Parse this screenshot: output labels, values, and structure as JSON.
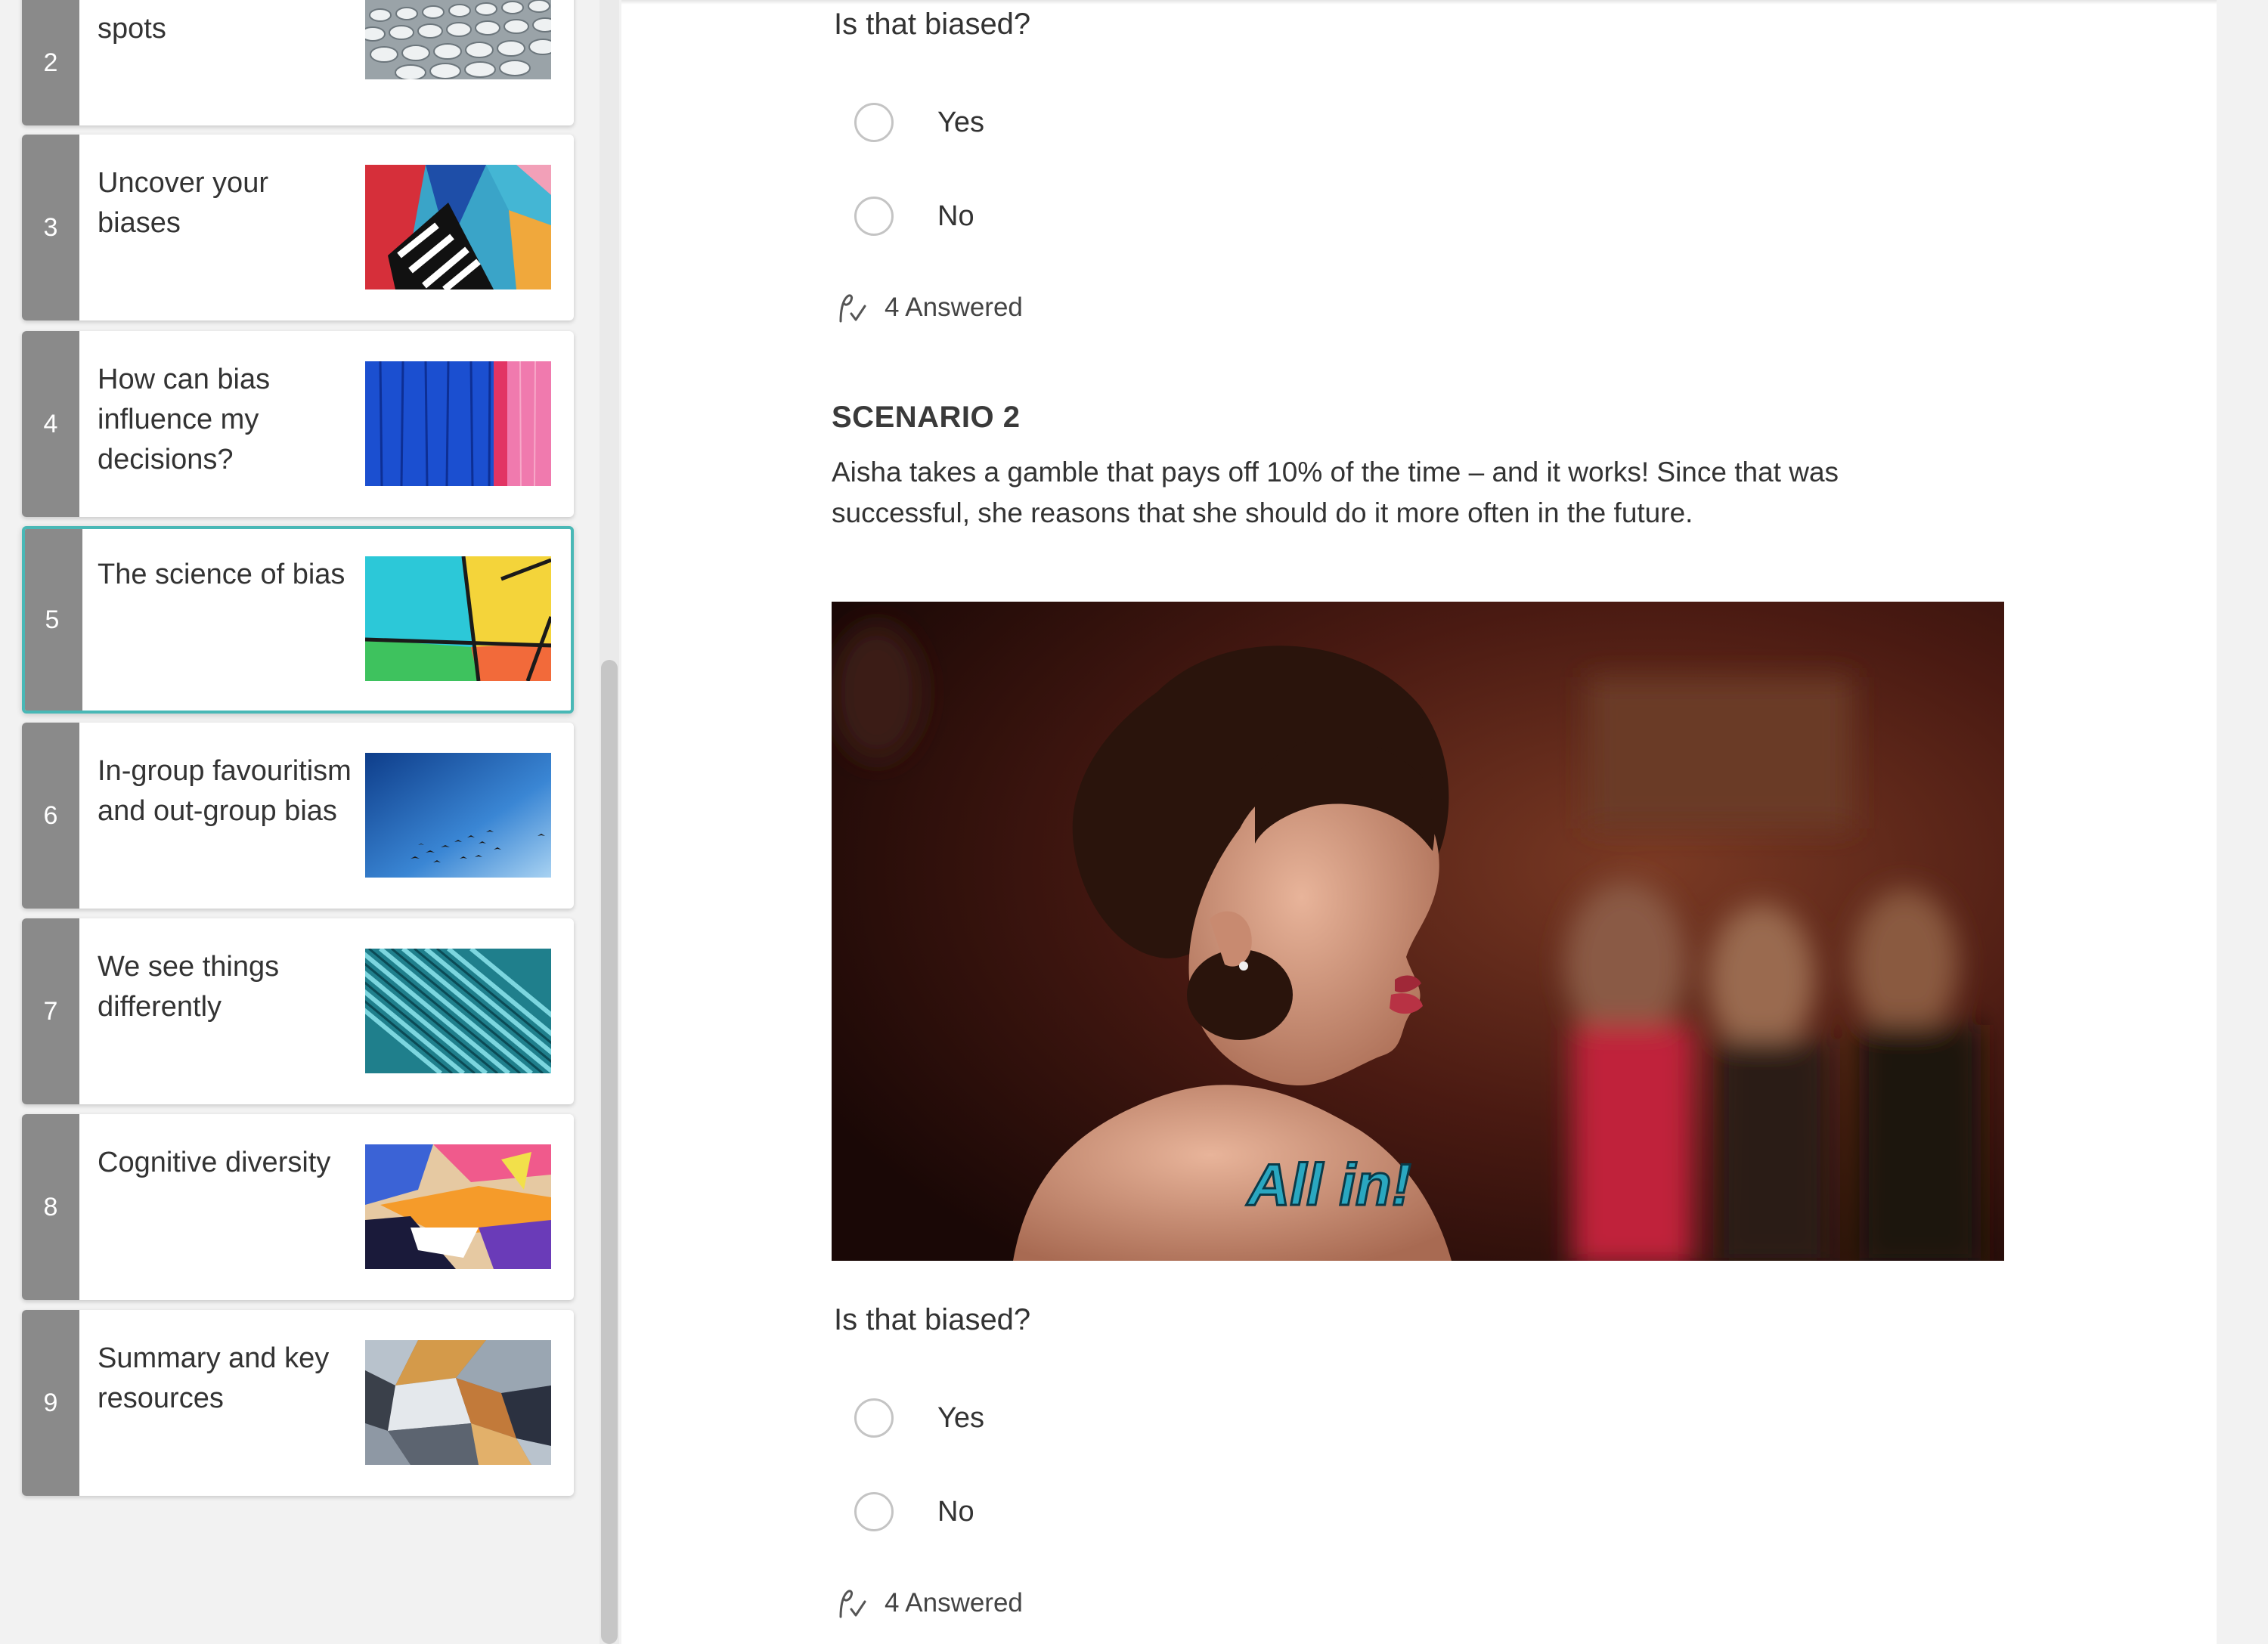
{
  "sidebar": {
    "cards": [
      {
        "number": "2",
        "title": "spots",
        "thumb": "white-dots-pattern"
      },
      {
        "number": "3",
        "title": "Uncover your biases",
        "thumb": "colorful-geometric-mural"
      },
      {
        "number": "4",
        "title": "How can bias influence my decisions?",
        "thumb": "blue-pink-painted-wood"
      },
      {
        "number": "5",
        "title": "The science of bias",
        "thumb": "colored-glass-panels",
        "active": true
      },
      {
        "number": "6",
        "title": "In-group favouritism and out-group bias",
        "thumb": "birds-in-blue-sky"
      },
      {
        "number": "7",
        "title": "We see things differently",
        "thumb": "teal-building-facade"
      },
      {
        "number": "8",
        "title": "Cognitive diversity",
        "thumb": "graffiti-wall"
      },
      {
        "number": "9",
        "title": "Summary and key resources",
        "thumb": "holographic-foil"
      }
    ]
  },
  "main": {
    "question1": {
      "prompt": "Is that biased?",
      "options": [
        "Yes",
        "No"
      ],
      "answered": "4 Answered"
    },
    "scenario": {
      "heading": "SCENARIO 2",
      "text": "Aisha takes a gamble that pays off 10% of the time – and it works! Since that was successful, she reasons that she should do it more often in the future.",
      "gif_caption": "All in!"
    },
    "question2": {
      "prompt": "Is that biased?",
      "options": [
        "Yes",
        "No"
      ],
      "answered": "4 Answered"
    }
  },
  "colors": {
    "accent": "#49b8b6",
    "number_bar": "#8a8a8a",
    "background": "#f2f2f2"
  }
}
